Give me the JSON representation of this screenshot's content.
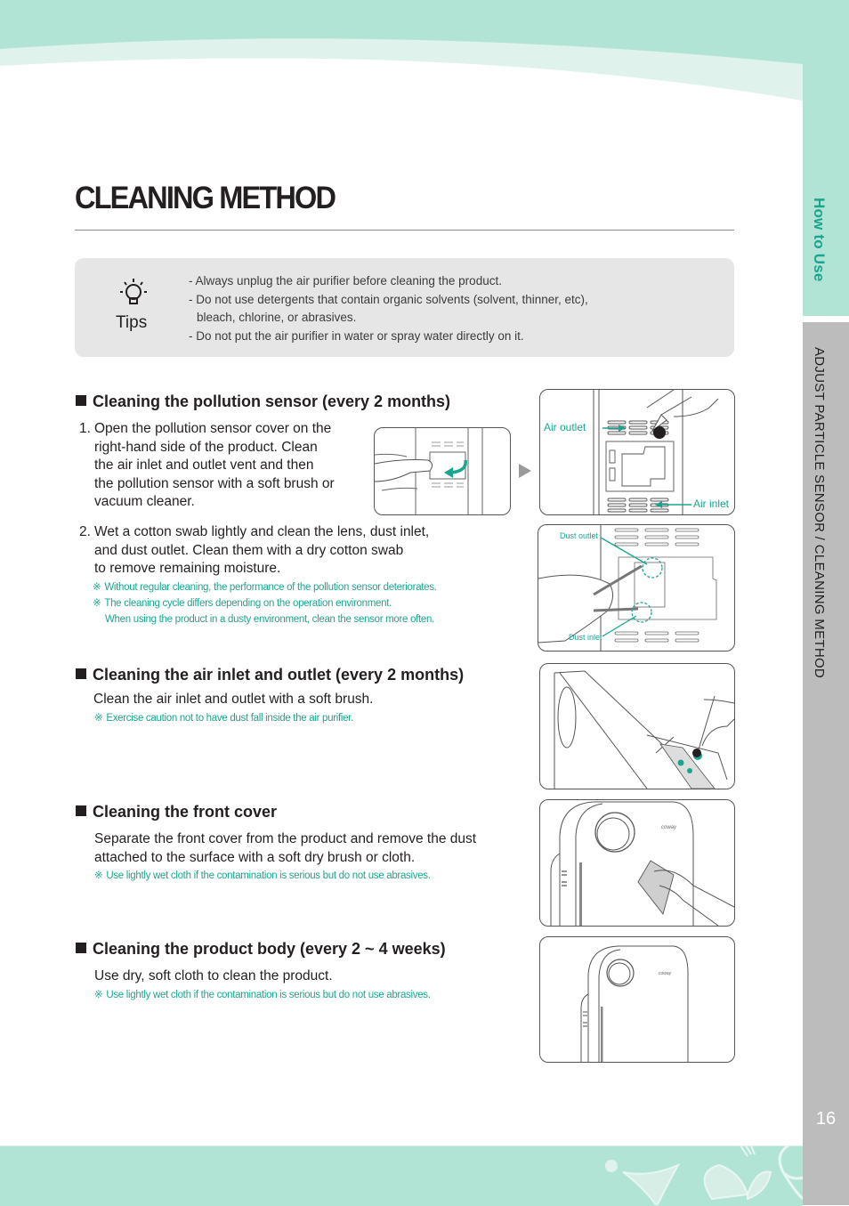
{
  "header": {
    "title": "CLEANING METHOD"
  },
  "side_tab": {
    "section": "How to Use",
    "subsection": "ADJUST PARTICLE SENSOR  /  CLEANING METHOD",
    "page_number": "16"
  },
  "tips": {
    "icon": "lightbulb-icon",
    "label": "Tips",
    "items": [
      "- Always unplug the air purifier before cleaning the product.",
      "- Do not use detergents that contain organic solvents (solvent, thinner, etc),",
      "   bleach, chlorine, or abrasives.",
      "- Do not put the air purifier in water or spray water directly on it."
    ]
  },
  "sections": [
    {
      "heading": "Cleaning the pollution sensor (every 2 months)",
      "steps": [
        {
          "number": "1.",
          "lines": [
            "Open the pollution sensor cover on the",
            "right-hand side of the product. Clean",
            "the air inlet and outlet vent and then",
            "the pollution sensor with a soft brush or",
            "vacuum cleaner."
          ]
        },
        {
          "number": "2.",
          "lines": [
            "Wet a cotton swab lightly and clean the lens, dust inlet,",
            "and dust outlet. Clean them with a dry cotton swab",
            "to remove remaining moisture."
          ]
        }
      ],
      "notes": [
        "Without regular cleaning, the performance of the pollution sensor deteriorates.",
        "The cleaning cycle differs depending on the operation environment.",
        "When using the product in a dusty environment, clean the sensor more often."
      ],
      "figure_labels": {
        "air_outlet": "Air outlet",
        "air_inlet": "Air inlet",
        "dust_outlet": "Dust outlet",
        "dust_inlet": "Dust inlet"
      }
    },
    {
      "heading": "Cleaning the air inlet and outlet (every 2 months)",
      "text": "Clean the air inlet and outlet with a soft brush.",
      "note": "Exercise caution not to have dust fall inside the air purifier."
    },
    {
      "heading": "Cleaning the front cover",
      "text_lines": [
        "Separate the front cover from the product and remove the dust",
        "attached to the surface with a soft dry brush or cloth."
      ],
      "note": "Use lightly wet cloth if the contamination is serious but do not use abrasives."
    },
    {
      "heading": "Cleaning the product body (every 2 ~ 4 weeks)",
      "text": "Use dry, soft cloth to clean the product.",
      "note": "Use lightly wet cloth if the contamination is serious but do not use abrasives."
    }
  ],
  "brand_mark": "coway",
  "note_symbol": "※",
  "colors": {
    "accent_green": "#1aa68e",
    "band_mint": "#b2e4d6",
    "band_light": "#e0f2ec",
    "side_gray": "#bcbcbc",
    "tips_bg": "#e6e6e6"
  }
}
